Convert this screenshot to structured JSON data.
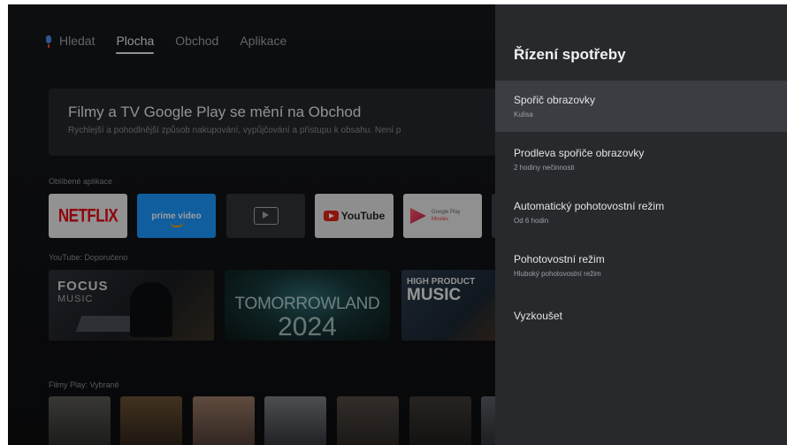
{
  "nav": {
    "search": "Hledat",
    "tabs": [
      "Plocha",
      "Obchod",
      "Aplikace"
    ]
  },
  "banner": {
    "title": "Filmy a TV Google Play se mění na Obchod",
    "subtitle": "Rychlejší a pohodlnější způsob nakupování, vypůjčování a přístupu k obsahu. Není p"
  },
  "rows": {
    "favorite_apps": "Oblíbené aplikace",
    "youtube": "YouTube: Doporučeno",
    "films": "Filmy Play: Vybrané"
  },
  "apps": {
    "netflix": "NETFLIX",
    "prime": "prime video",
    "youtube": "YouTube",
    "gpm_line1": "Google Play",
    "gpm_line2": "Movies"
  },
  "thumbs": {
    "focus_line1": "FOCUS",
    "focus_line2": "MUSIC",
    "tomorrowland_line1": "TOMORROWLAND",
    "tomorrowland_line2": "2024",
    "hp_line1": "HIGH PRODUCT",
    "hp_line2": "MUSIC"
  },
  "panel": {
    "title": "Řízení spotřeby",
    "items": [
      {
        "label": "Spořič obrazovky",
        "sub": "Kulisa"
      },
      {
        "label": "Prodleva spořiče obrazovky",
        "sub": "2 hodiny nečinnosti"
      },
      {
        "label": "Automatický pohotovostní režim",
        "sub": "Od 6 hodin"
      },
      {
        "label": "Pohotovostní režim",
        "sub": "Hluboký pohotovostní režim"
      },
      {
        "label": "Vyzkoušet",
        "sub": ""
      }
    ]
  },
  "colors": {
    "panel_bg": "#27292c",
    "selected_bg": "#3a3d41",
    "mic_accent": "#4a8cf0"
  }
}
